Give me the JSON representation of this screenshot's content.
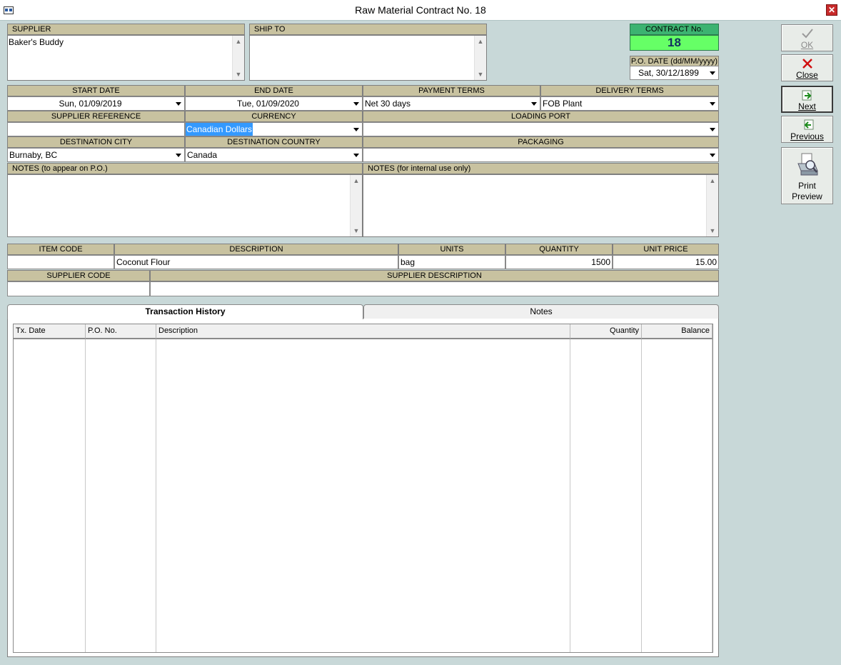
{
  "window": {
    "title": "Raw Material Contract No. 18",
    "close_label": "✕"
  },
  "supplier": {
    "label": "SUPPLIER",
    "value": "Baker's Buddy"
  },
  "ship_to": {
    "label": "SHIP TO",
    "value": ""
  },
  "contract": {
    "label": "CONTRACT No.",
    "value": "18"
  },
  "po_date": {
    "label": "P.O. DATE (dd/MM/yyyy)",
    "value": "Sat, 30/12/1899"
  },
  "start_date": {
    "label": "START DATE",
    "value": "Sun, 01/09/2019"
  },
  "end_date": {
    "label": "END DATE",
    "value": "Tue, 01/09/2020"
  },
  "payment_terms": {
    "label": "PAYMENT TERMS",
    "value": "Net 30 days"
  },
  "delivery_terms": {
    "label": "DELIVERY TERMS",
    "value": "FOB Plant"
  },
  "supplier_reference": {
    "label": "SUPPLIER REFERENCE",
    "value": ""
  },
  "currency": {
    "label": "CURRENCY",
    "value": "Canadian Dollars"
  },
  "loading_port": {
    "label": "LOADING PORT",
    "value": ""
  },
  "destination_city": {
    "label": "DESTINATION CITY",
    "value": "Burnaby, BC"
  },
  "destination_country": {
    "label": "DESTINATION COUNTRY",
    "value": "Canada"
  },
  "packaging": {
    "label": "PACKAGING",
    "value": ""
  },
  "notes_po": {
    "label": "NOTES (to appear on P.O.)",
    "value": ""
  },
  "notes_internal": {
    "label": "NOTES (for internal use only)",
    "value": ""
  },
  "item": {
    "code_label": "ITEM CODE",
    "code": "",
    "description_label": "DESCRIPTION",
    "description": "Coconut Flour",
    "units_label": "UNITS",
    "units": "bag",
    "quantity_label": "QUANTITY",
    "quantity": "1500",
    "unit_price_label": "UNIT PRICE",
    "unit_price": "15.00",
    "supplier_code_label": "SUPPLIER CODE",
    "supplier_code": "",
    "supplier_description_label": "SUPPLIER DESCRIPTION",
    "supplier_description": ""
  },
  "buttons": {
    "ok": "OK",
    "close": "Close",
    "next": "Next",
    "previous": "Previous",
    "print_preview_1": "Print",
    "print_preview_2": "Preview"
  },
  "tabs": [
    {
      "label": "Transaction History",
      "active": true
    },
    {
      "label": "Notes",
      "active": false
    }
  ],
  "history": {
    "columns": [
      "Tx. Date",
      "P.O. No.",
      "Description",
      "Quantity",
      "Balance"
    ],
    "rows": []
  },
  "icons": {
    "app": "window-icon",
    "ok": "checkmark-icon",
    "close": "red-x-icon",
    "next": "next-arrow-icon",
    "previous": "previous-arrow-icon",
    "print_preview": "printer-icon"
  },
  "colors": {
    "background": "#c8d8d8",
    "header": "#c8c2a0",
    "contract_header": "#3cb371",
    "contract_value": "#66ff66",
    "selection": "#3399ff"
  }
}
